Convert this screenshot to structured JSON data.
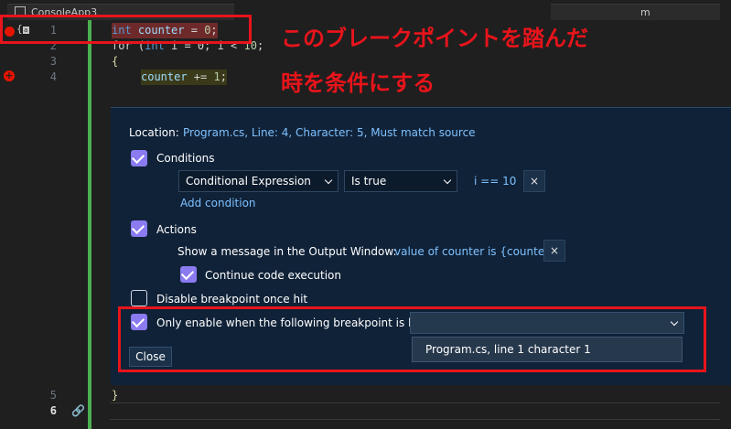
{
  "tabs": [
    {
      "label": "ConsoleApp3"
    },
    {
      "label": "m"
    }
  ],
  "editor": {
    "line_numbers": [
      "1",
      "2",
      "3",
      "4",
      "5",
      "6"
    ],
    "code": {
      "line1": {
        "kw": "int",
        "var": "counter",
        "rest": " = ",
        "num": "0",
        "end": ";"
      },
      "line2": {
        "pre": "for (",
        "kw": "int",
        "mid": " i = 0; i < ",
        "num": "10",
        "end": ";"
      },
      "line3": "{",
      "line4": {
        "var": "counter",
        "rest": " += ",
        "num": "1",
        "end": ";"
      },
      "line5": "}",
      "line6": ""
    }
  },
  "annotation": {
    "line1": "このブレークポイントを踏んだ",
    "line2": "時を条件にする"
  },
  "breakpoint_settings": {
    "location_label": "Location:",
    "location_value": "Program.cs, Line: 4, Character: 5, Must match source",
    "conditions": {
      "label": "Conditions",
      "checked": true,
      "type": "Conditional Expression",
      "mode": "Is true",
      "expression": "i == 10",
      "remove_label": "×",
      "add_label": "Add condition"
    },
    "actions": {
      "label": "Actions",
      "checked": true,
      "message_label": "Show a message in the Output Window:",
      "message_value": "value of counter is {counter}",
      "remove_label": "×",
      "continue_label": "Continue code execution",
      "continue_checked": true
    },
    "disable_once_hit": {
      "label": "Disable breakpoint once hit",
      "checked": false
    },
    "only_enable": {
      "label": "Only enable when the following breakpoint is hit:",
      "checked": true,
      "selected": "",
      "options": [
        "Program.cs, line 1 character 1"
      ]
    },
    "close_label": "Close"
  },
  "colors": {
    "annotation_red": "#e8141b",
    "checkbox_purple": "#8a7bf0",
    "panel_bg": "#102238",
    "breakpoint_red": "#e51400",
    "change_bar_green": "#4caf50"
  },
  "icons": [
    "breakpoint-icon",
    "conditional-breakpoint-icon",
    "code-lens-icon",
    "link-icon",
    "chevron-down-icon",
    "close-icon",
    "check-icon"
  ]
}
